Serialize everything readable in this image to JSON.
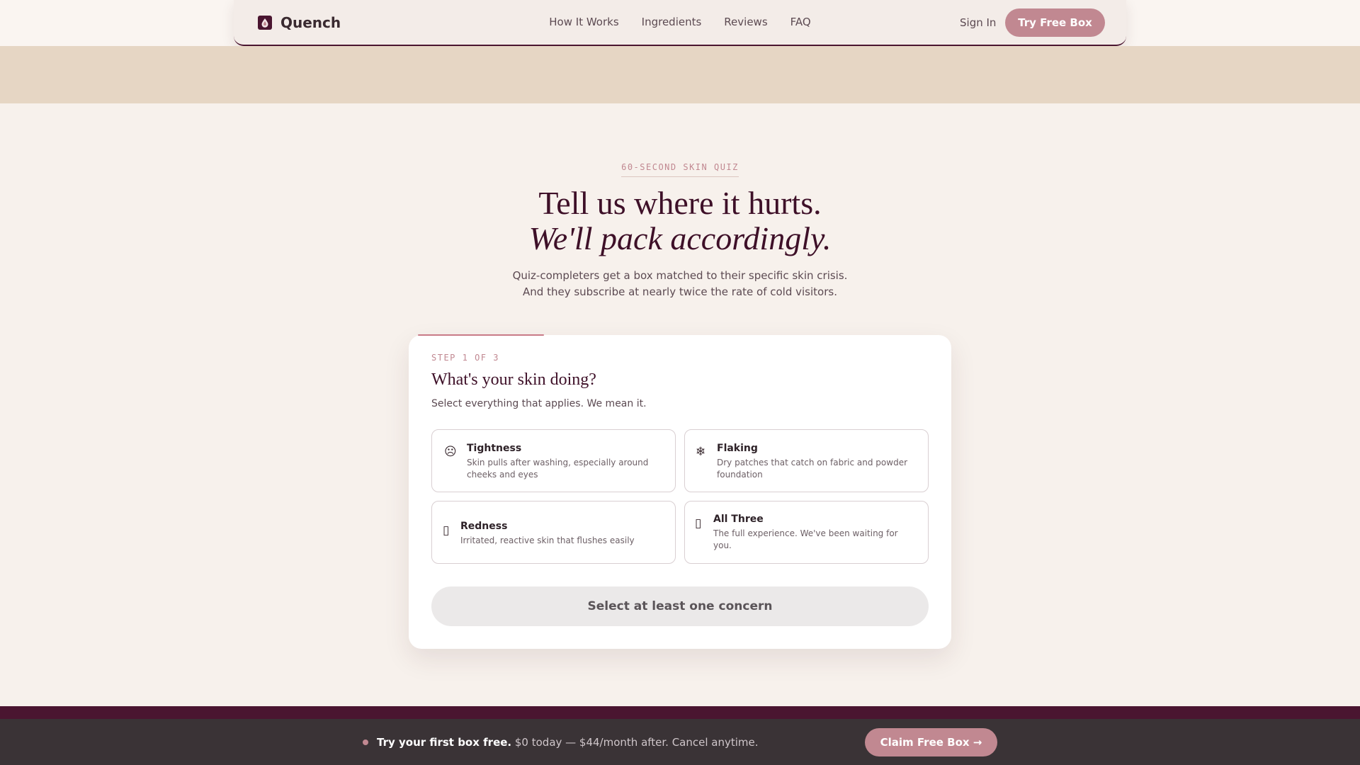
{
  "colors": {
    "accent": "#c18891",
    "brand_dark": "#4a1530",
    "heading": "#3e1028",
    "band": "#e6d6c4",
    "page_bg": "#f7f1ec",
    "footer_bg": "#3a3336"
  },
  "nav": {
    "brand": "Quench",
    "links": [
      "How It Works",
      "Ingredients",
      "Reviews",
      "FAQ"
    ],
    "sign_in": "Sign In",
    "cta": "Try Free Box"
  },
  "hero": {
    "eyebrow": "60-SECOND SKIN QUIZ",
    "title_line1": "Tell us where it hurts.",
    "title_line2": "We'll pack accordingly.",
    "sub_line1": "Quiz-completers get a box matched to their specific skin crisis.",
    "sub_line2": "And they subscribe at nearly twice the rate of cold visitors."
  },
  "quiz": {
    "step": "STEP 1 OF 3",
    "progress": 0.33,
    "question": "What's your skin doing?",
    "instruction": "Select everything that applies. We mean it.",
    "options": [
      {
        "icon": "frown-face-icon",
        "glyph": "☹",
        "title": "Tightness",
        "desc_line1": "Skin pulls after washing, especially around",
        "desc_line2": "cheeks and eyes"
      },
      {
        "icon": "snowflake-icon",
        "glyph": "❄",
        "title": "Flaking",
        "desc_line1": "Dry patches that catch on fabric and powder",
        "desc_line2": "foundation"
      },
      {
        "icon": "flame-icon",
        "glyph": "▯",
        "title": "Redness",
        "desc_line1": "Irritated, reactive skin that flushes easily",
        "desc_line2": ""
      },
      {
        "icon": "sparkle-icon",
        "glyph": "▯",
        "title": "All Three",
        "desc_line1": "The full experience. We've been waiting for",
        "desc_line2": "you."
      }
    ],
    "submit_label": "Select at least one concern"
  },
  "sticky": {
    "bold": "Try your first box free.",
    "rest": "$0 today — $44/month after. Cancel anytime.",
    "cta": "Claim Free Box →"
  }
}
